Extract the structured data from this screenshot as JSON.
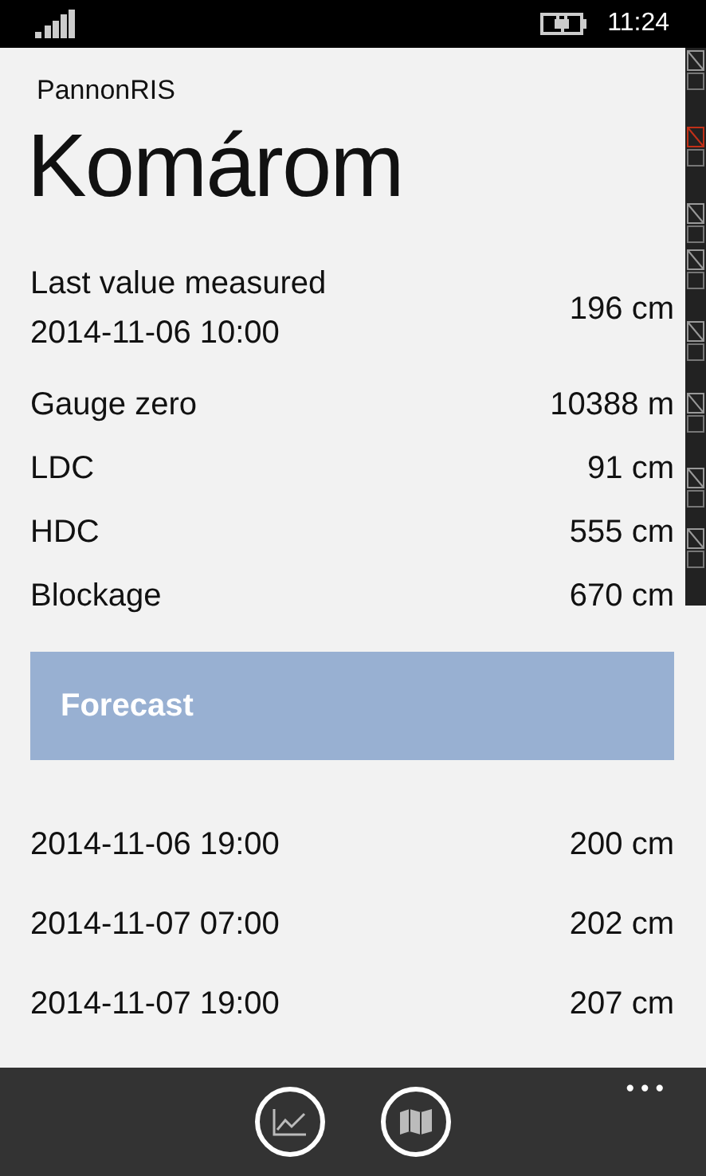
{
  "status_bar": {
    "time": "11:24"
  },
  "app_name": "PannonRIS",
  "title": "Komárom",
  "last_value": {
    "label": "Last value measured",
    "date": "2014-11-06 10:00",
    "value": "196 cm"
  },
  "details": [
    {
      "label": "Gauge zero",
      "value": "10388 m"
    },
    {
      "label": "LDC",
      "value": "91 cm"
    },
    {
      "label": "HDC",
      "value": "555 cm"
    },
    {
      "label": "Blockage",
      "value": "670 cm"
    }
  ],
  "forecast": {
    "title": "Forecast",
    "rows": [
      {
        "time": "2014-11-06 19:00",
        "value": "200 cm"
      },
      {
        "time": "2014-11-07 07:00",
        "value": "202 cm"
      },
      {
        "time": "2014-11-07 19:00",
        "value": "207 cm"
      }
    ]
  },
  "app_bar": {
    "more": "•••"
  }
}
